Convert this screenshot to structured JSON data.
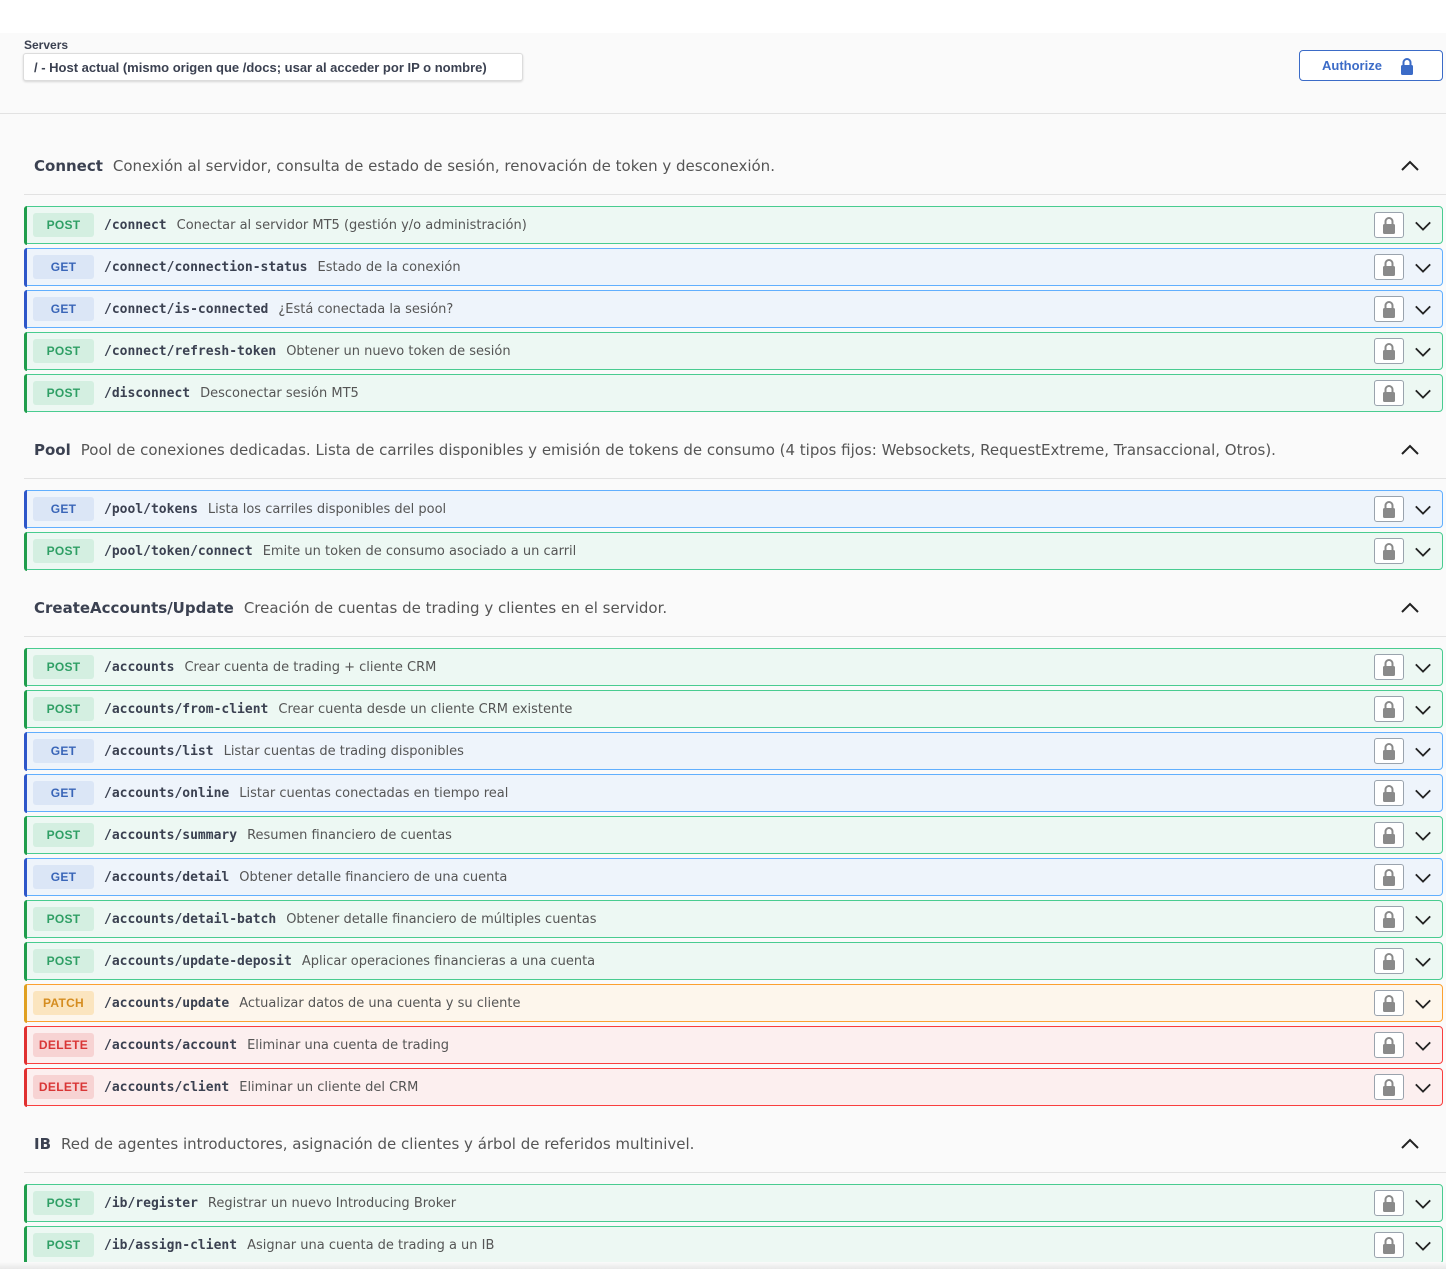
{
  "servers": {
    "label": "Servers",
    "selected": "/ - Host actual (mismo origen que /docs; usar al acceder por IP o nombre)"
  },
  "authorize": {
    "label": "Authorize",
    "icon": "lock-icon"
  },
  "colors": {
    "post": "#49cc90",
    "get": "#61affe",
    "patch": "#fca130",
    "delete": "#f93e3e"
  },
  "tags": [
    {
      "name": "Connect",
      "description": "Conexión al servidor, consulta de estado de sesión, renovación de token y desconexión.",
      "expanded": true,
      "operations": [
        {
          "method": "POST",
          "path": "/connect",
          "summary": "Conectar al servidor MT5 (gestión y/o administración)"
        },
        {
          "method": "GET",
          "path": "/connect/connection-status",
          "summary": "Estado de la conexión"
        },
        {
          "method": "GET",
          "path": "/connect/is-connected",
          "summary": "¿Está conectada la sesión?"
        },
        {
          "method": "POST",
          "path": "/connect/refresh-token",
          "summary": "Obtener un nuevo token de sesión"
        },
        {
          "method": "POST",
          "path": "/disconnect",
          "summary": "Desconectar sesión MT5"
        }
      ]
    },
    {
      "name": "Pool",
      "description": "Pool de conexiones dedicadas. Lista de carriles disponibles y emisión de tokens de consumo (4 tipos fijos: Websockets, RequestExtreme, Transaccional, Otros).",
      "expanded": true,
      "operations": [
        {
          "method": "GET",
          "path": "/pool/tokens",
          "summary": "Lista los carriles disponibles del pool"
        },
        {
          "method": "POST",
          "path": "/pool/token/connect",
          "summary": "Emite un token de consumo asociado a un carril"
        }
      ]
    },
    {
      "name": "CreateAccounts/Update",
      "description": "Creación de cuentas de trading y clientes en el servidor.",
      "expanded": true,
      "operations": [
        {
          "method": "POST",
          "path": "/accounts",
          "summary": "Crear cuenta de trading + cliente CRM"
        },
        {
          "method": "POST",
          "path": "/accounts/from-client",
          "summary": "Crear cuenta desde un cliente CRM existente"
        },
        {
          "method": "GET",
          "path": "/accounts/list",
          "summary": "Listar cuentas de trading disponibles"
        },
        {
          "method": "GET",
          "path": "/accounts/online",
          "summary": "Listar cuentas conectadas en tiempo real"
        },
        {
          "method": "POST",
          "path": "/accounts/summary",
          "summary": "Resumen financiero de cuentas"
        },
        {
          "method": "GET",
          "path": "/accounts/detail",
          "summary": "Obtener detalle financiero de una cuenta"
        },
        {
          "method": "POST",
          "path": "/accounts/detail-batch",
          "summary": "Obtener detalle financiero de múltiples cuentas"
        },
        {
          "method": "POST",
          "path": "/accounts/update-deposit",
          "summary": "Aplicar operaciones financieras a una cuenta"
        },
        {
          "method": "PATCH",
          "path": "/accounts/update",
          "summary": "Actualizar datos de una cuenta y su cliente"
        },
        {
          "method": "DELETE",
          "path": "/accounts/account",
          "summary": "Eliminar una cuenta de trading"
        },
        {
          "method": "DELETE",
          "path": "/accounts/client",
          "summary": "Eliminar un cliente del CRM"
        }
      ]
    },
    {
      "name": "IB",
      "description": "Red de agentes introductores, asignación de clientes y árbol de referidos multinivel.",
      "expanded": true,
      "operations": [
        {
          "method": "POST",
          "path": "/ib/register",
          "summary": "Registrar un nuevo Introducing Broker"
        },
        {
          "method": "POST",
          "path": "/ib/assign-client",
          "summary": "Asignar una cuenta de trading a un IB"
        }
      ]
    }
  ]
}
